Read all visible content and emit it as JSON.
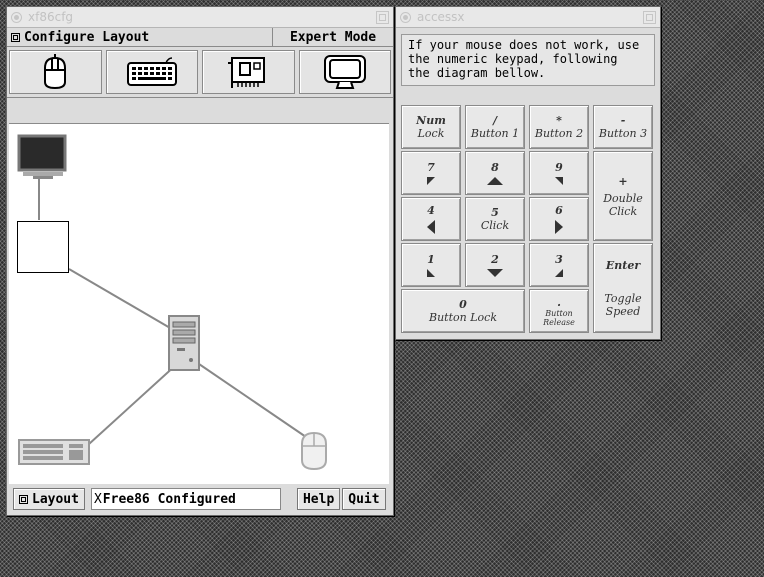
{
  "xf86cfg": {
    "title": "xf86cfg",
    "menu_configure": "Configure Layout",
    "menu_expert": "Expert Mode",
    "toolbar": [
      {
        "icon": "mouse-icon"
      },
      {
        "icon": "keyboard-icon"
      },
      {
        "icon": "card-icon"
      },
      {
        "icon": "monitor-icon"
      }
    ],
    "layout_button": "Layout",
    "status_text": "Free86 Configured",
    "status_cursor": "X",
    "help_button": "Help",
    "quit_button": "Quit"
  },
  "accessx": {
    "title": "accessx",
    "help_text": "If your mouse does not work, use\nthe numeric keypad, following\nthe diagram bellow.",
    "keys": {
      "numlock": {
        "top": "Num",
        "label": "Lock"
      },
      "slash": {
        "top": "/",
        "label": "Button 1"
      },
      "star": {
        "top": "*",
        "label": "Button 2"
      },
      "minus": {
        "top": "-",
        "label": "Button 3"
      },
      "k7": {
        "top": "7"
      },
      "k8": {
        "top": "8"
      },
      "k9": {
        "top": "9"
      },
      "plus": {
        "top": "+",
        "label": "Double Click"
      },
      "k4": {
        "top": "4"
      },
      "k5": {
        "top": "5",
        "label": "Click"
      },
      "k6": {
        "top": "6"
      },
      "k1": {
        "top": "1"
      },
      "k2": {
        "top": "2"
      },
      "k3": {
        "top": "3"
      },
      "enter": {
        "top": "Enter",
        "label": "Toggle Speed"
      },
      "k0": {
        "top": "0",
        "label": "Button Lock"
      },
      "dot": {
        "top": ".",
        "label": "Button Release"
      }
    }
  }
}
